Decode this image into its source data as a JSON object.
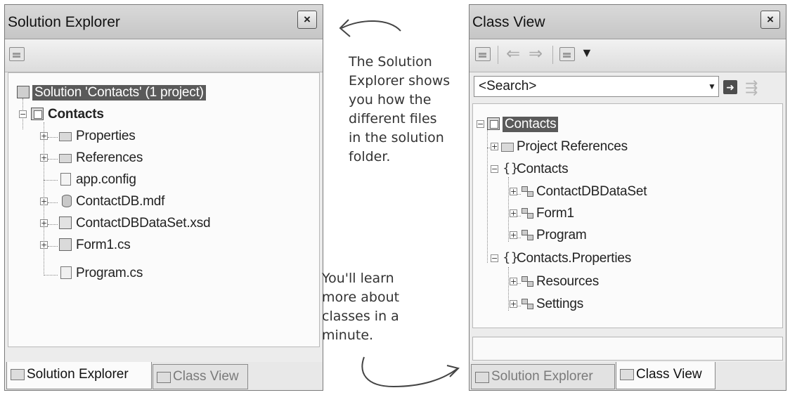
{
  "solution_explorer": {
    "title": "Solution Explorer",
    "close_label": "×",
    "tree": [
      {
        "label": "Solution 'Contacts' (1 project)",
        "icon": "solution-icon",
        "selected": true
      },
      {
        "label": "Contacts",
        "icon": "project-icon",
        "bold": true
      },
      {
        "label": "Properties",
        "icon": "properties-folder-icon"
      },
      {
        "label": "References",
        "icon": "references-folder-icon"
      },
      {
        "label": "app.config",
        "icon": "config-file-icon"
      },
      {
        "label": "ContactDB.mdf",
        "icon": "database-icon"
      },
      {
        "label": "ContactDBDataSet.xsd",
        "icon": "dataset-icon"
      },
      {
        "label": "Form1.cs",
        "icon": "form-icon"
      },
      {
        "label": "Program.cs",
        "icon": "cs-file-icon"
      }
    ],
    "tabs": [
      "Solution Explorer",
      "Class View"
    ],
    "active_tab": "Solution Explorer"
  },
  "class_view": {
    "title": "Class View",
    "close_label": "×",
    "search_value": "<Search>",
    "tree": [
      {
        "label": "Contacts",
        "icon": "project-icon",
        "selected": true
      },
      {
        "label": "Project References",
        "icon": "folder-icon"
      },
      {
        "label": "Contacts",
        "icon": "namespace-icon"
      },
      {
        "label": "ContactDBDataSet",
        "icon": "class-icon"
      },
      {
        "label": "Form1",
        "icon": "class-icon"
      },
      {
        "label": "Program",
        "icon": "class-icon"
      },
      {
        "label": "Contacts.Properties",
        "icon": "namespace-icon"
      },
      {
        "label": "Resources",
        "icon": "class-icon"
      },
      {
        "label": "Settings",
        "icon": "class-icon"
      }
    ],
    "tabs": [
      "Solution Explorer",
      "Class View"
    ],
    "active_tab": "Class View"
  },
  "notes": {
    "top": "The Solution\nExplorer shows\nyou how the\ndifferent files\nin the solution\nfolder.",
    "bottom": "You'll learn\nmore about\nclasses in a\nminute."
  }
}
